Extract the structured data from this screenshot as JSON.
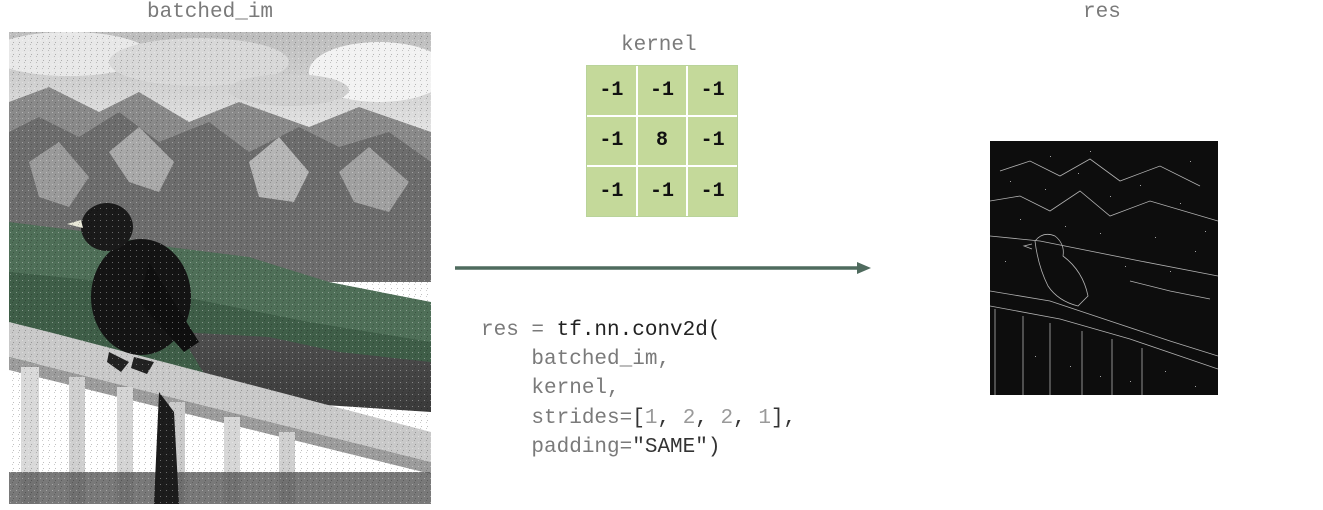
{
  "labels": {
    "input_title": "batched_im",
    "kernel_title": "kernel",
    "output_title": "res"
  },
  "kernel": {
    "rows": [
      [
        "-1",
        "-1",
        "-1"
      ],
      [
        "-1",
        "8",
        "-1"
      ],
      [
        "-1",
        "-1",
        "-1"
      ]
    ],
    "cell_color": "#c4d99a"
  },
  "code": {
    "line1": {
      "var": "res",
      "op": " = ",
      "fn": "tf.nn.conv2d("
    },
    "line2": {
      "arg": "batched_im,"
    },
    "line3": {
      "arg": "kernel,"
    },
    "line4": {
      "kw": "strides=",
      "open": "[",
      "n1": "1",
      "n2": "2",
      "n3": "2",
      "n4": "1",
      "close": "],"
    },
    "line5": {
      "kw": "padding=",
      "str": "\"SAME\"",
      "close": ")"
    }
  },
  "colors": {
    "arrow": "#4f6b5e",
    "label_text": "#7a7a7a",
    "output_bg": "#0d0d0d"
  },
  "images": {
    "input": "bird-on-railing-photo",
    "output": "edge-detected-bird-photo"
  }
}
